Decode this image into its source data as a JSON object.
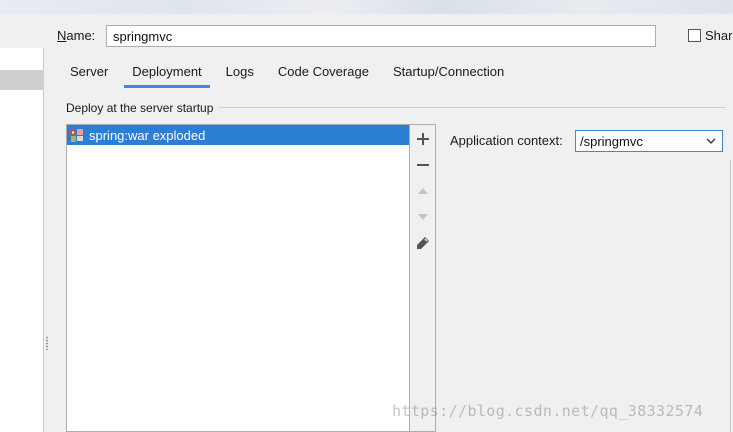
{
  "name_row": {
    "label": "Name:",
    "value": "springmvc",
    "share_label": "Share"
  },
  "tabs": [
    {
      "label": "Server",
      "active": false
    },
    {
      "label": "Deployment",
      "active": true
    },
    {
      "label": "Logs",
      "active": false
    },
    {
      "label": "Code Coverage",
      "active": false
    },
    {
      "label": "Startup/Connection",
      "active": false
    }
  ],
  "deployment": {
    "group_title": "Deploy at the server startup",
    "items": [
      {
        "label": "spring:war exploded",
        "icon": "war-artifact-icon",
        "selected": true
      }
    ],
    "toolbar": [
      "add-icon",
      "remove-icon",
      "move-up-icon",
      "move-down-icon",
      "edit-icon"
    ],
    "context_label": "Application context:",
    "context_value": "/springmvc"
  },
  "colors": {
    "accent": "#3c8ad9",
    "selection": "#2a7fd4"
  },
  "watermark": "https://blog.csdn.net/qq_38332574"
}
